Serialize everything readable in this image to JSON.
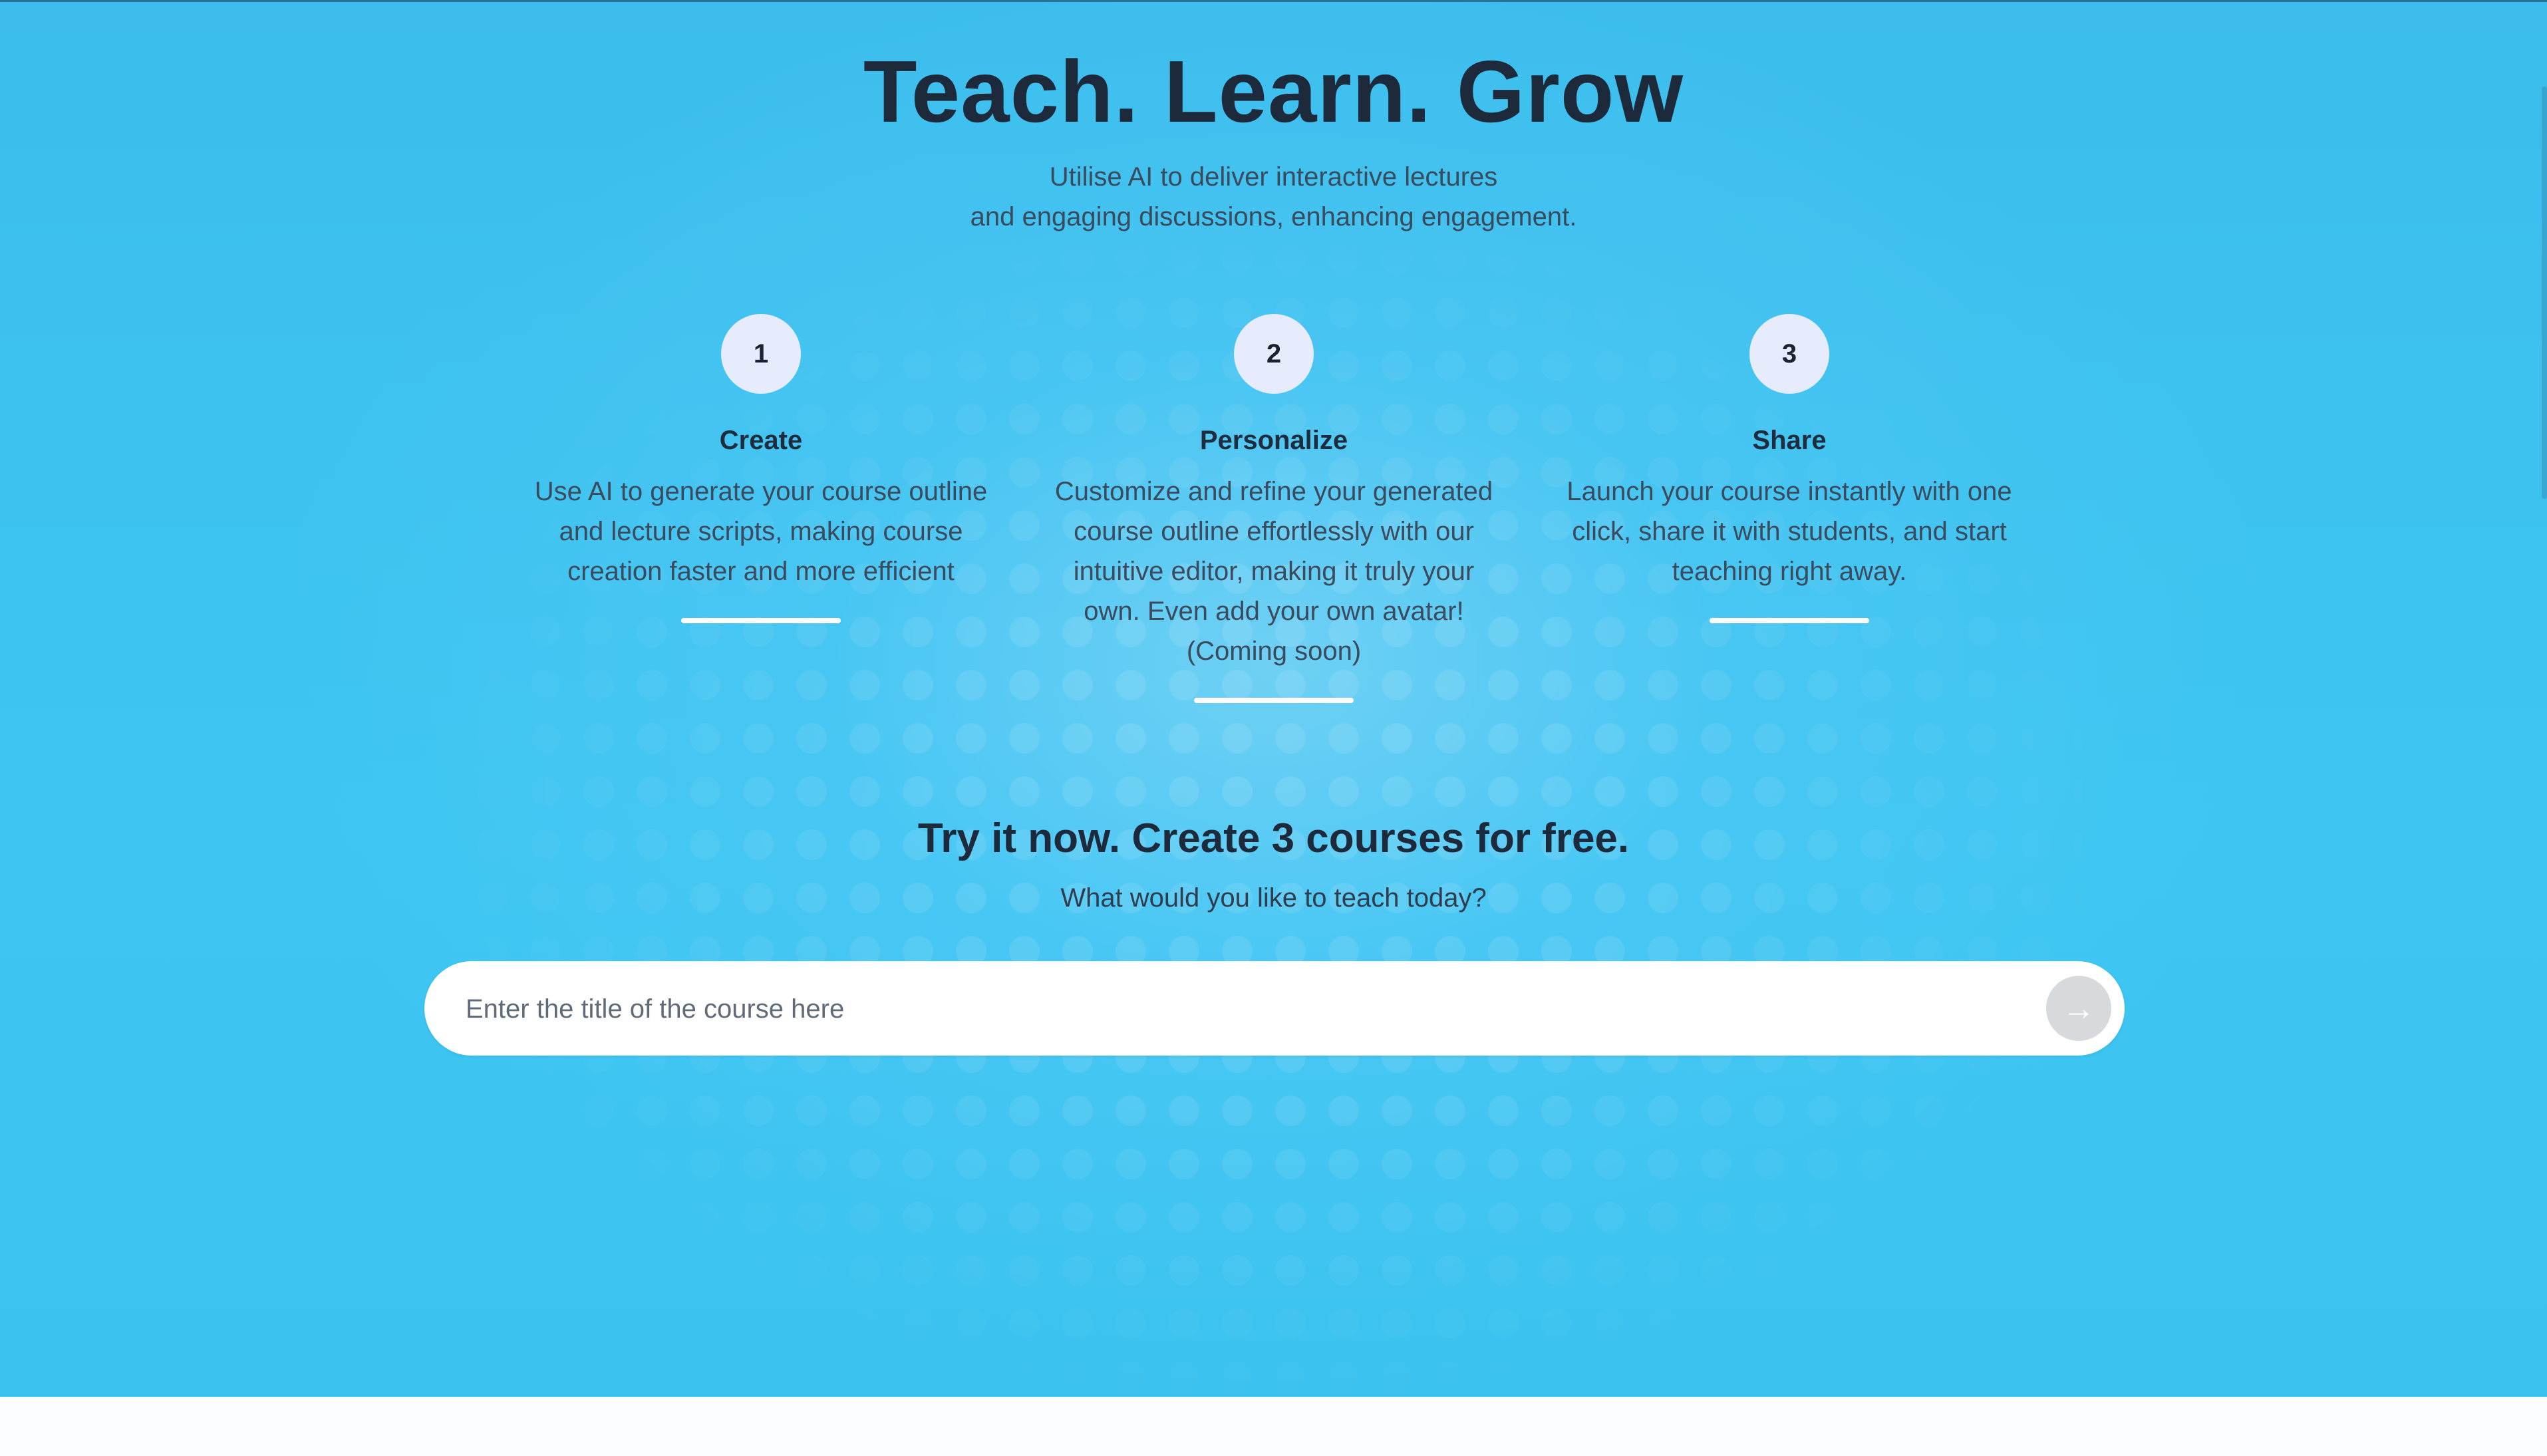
{
  "hero": {
    "title": "Teach. Learn. Grow",
    "subtitle_line1": "Utilise AI to deliver interactive lectures",
    "subtitle_line2": "and engaging discussions, enhancing engagement."
  },
  "steps": [
    {
      "number": "1",
      "title": "Create",
      "description_lines": [
        "Use AI to generate your course outline",
        "and lecture scripts, making course",
        "creation faster and more efficient"
      ]
    },
    {
      "number": "2",
      "title": "Personalize",
      "description_lines": [
        "Customize and refine your generated",
        "course outline effortlessly with our",
        "intuitive editor, making it truly your",
        "own. Even add your own avatar!",
        "(Coming soon)"
      ]
    },
    {
      "number": "3",
      "title": "Share",
      "description_lines": [
        "Launch your course instantly with one",
        "click, share it with students, and start",
        "teaching right away."
      ]
    }
  ],
  "cta": {
    "title": "Try it now. Create 3 courses for free.",
    "subtitle": "What would you like to teach today?",
    "input_placeholder": "Enter the title of the course here",
    "input_value": "",
    "submit_icon": "arrow-right-icon",
    "submit_glyph": "→"
  },
  "colors": {
    "hero_background": "#3ec6f2",
    "heading_text": "#1d2a3b",
    "step_circle": "#e6ecfb",
    "submit_button": "#d8d9dc"
  }
}
